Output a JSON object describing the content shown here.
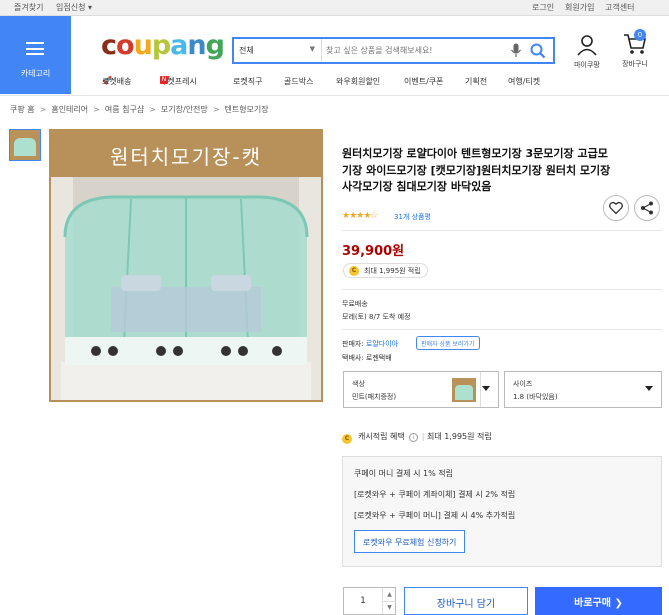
{
  "topbar": {
    "left": [
      "즐겨찾기",
      "입점신청 ▾"
    ],
    "right": [
      "로그인",
      "회원가입",
      "고객센터"
    ]
  },
  "category_button": {
    "label": "카테고리"
  },
  "logo": {
    "letters": [
      "c",
      "o",
      "u",
      "p",
      "a",
      "n",
      "g"
    ],
    "colors": [
      "#8b2c1a",
      "#d33b2c",
      "#f2a91c",
      "#b6c63a",
      "#4ab9e8",
      "#3c8ac9",
      "#42a65a"
    ]
  },
  "search": {
    "category": "전체",
    "placeholder": "찾고 싶은 상품을 검색해보세요!"
  },
  "header_icons": {
    "mycoupang": "마이쿠팡",
    "cart": "장바구니",
    "cart_count": "0"
  },
  "menu": [
    "로켓배송",
    "로켓프레시",
    "로켓직구",
    "골드박스",
    "와우회원할인",
    "이벤트/쿠폰",
    "기획전",
    "여행/티켓"
  ],
  "breadcrumb": [
    "쿠팡 홈",
    "홈인테리어",
    "여름 침구샵",
    "모기장/안전망",
    "텐트형모기장"
  ],
  "product": {
    "image_title": "원터치모기장-캣",
    "title": "원터치모기장 로얄다이아 텐트형모기장 3문모기장 고급모기장 와이드모기장 [캣모기장]원터치모기장 원터치 모기장 사각모기장 침대모기장 바닥있음",
    "rating_stars": "★★★★☆",
    "rating_value": 4.5,
    "reviews": "31개 상품평",
    "price": "39,900원",
    "cash_pill": "최대 1,995원 적립",
    "shipping_free": "무료배송",
    "shipping_date": "모레(토) 8/7 도착 예정",
    "seller_label": "판매자:",
    "seller_name": "로얄다이아",
    "seller_button": "판매자 상품 보러가기",
    "courier": "택배사: 로젠택배"
  },
  "options": {
    "color_label": "색상",
    "color_value": "민트(패치증정)",
    "size_label": "사이즈",
    "size_value": "1.8 (바닥있음)"
  },
  "cash": {
    "label": "캐시적립 혜택",
    "info": "i",
    "max": "최대 1,995원 적립"
  },
  "benefits": {
    "rows": [
      "쿠페이 머니 결제 시 1% 적립",
      "[로켓와우 + 쿠페이 계좌이체] 결제 시 2% 적립",
      "[로켓와우 + 쿠페이 머니] 결제 시 4% 추가적립"
    ],
    "trial_button": "로켓와우 무료체험 신청하기"
  },
  "purchase": {
    "quantity": "1",
    "cart_button": "장바구니 담기",
    "buy_button": "바로구매 ❯"
  },
  "colors": {
    "accent": "#4285f4",
    "price": "#ae0000",
    "buy": "#346aff",
    "star": "#f5a623"
  }
}
